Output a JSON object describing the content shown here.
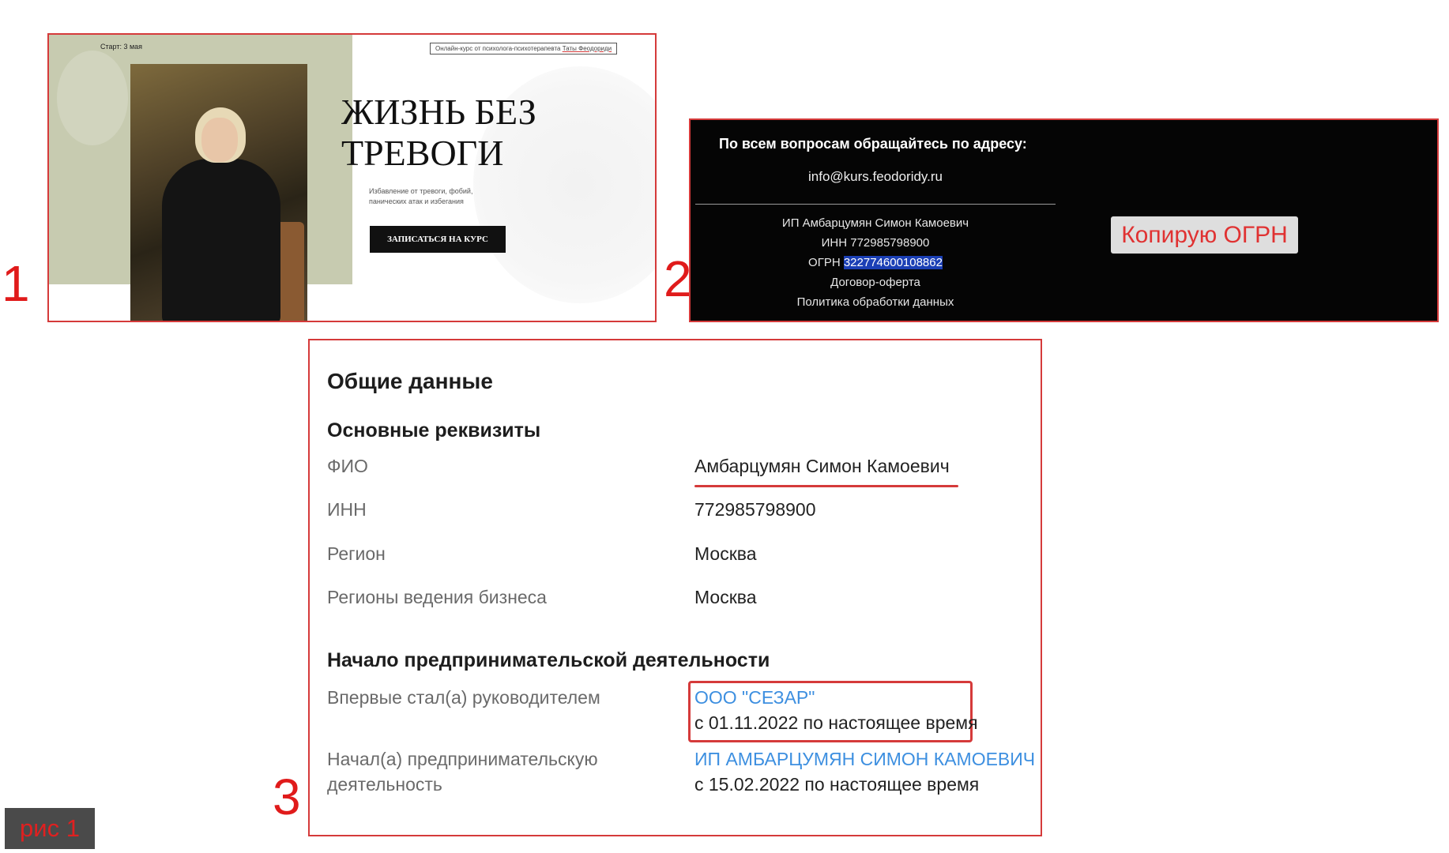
{
  "labels": {
    "one": "1",
    "two": "2",
    "three": "3",
    "tag": "рис 1"
  },
  "landing": {
    "start": "Старт: 3 мая",
    "badge_prefix": "Онлайн-курс от психолога-психотерапевта ",
    "badge_name": "Таты Феодориди",
    "title": "ЖИЗНЬ БЕЗ\nТРЕВОГИ",
    "subtitle": "Избавление от тревоги, фобий, панических атак и избегания",
    "cta": "ЗАПИСАТЬСЯ НА КУРС"
  },
  "footer": {
    "question": "По всем вопросам обращайтесь по адресу:",
    "email": "info@kurs.feodoridy.ru",
    "ip": "ИП Амбарцумян Симон Камоевич",
    "inn": "ИНН 772985798900",
    "ogrn_label": "ОГРН ",
    "ogrn_value": "322774600108862",
    "offer": "Договор-оферта",
    "policy": "Политика обработки данных",
    "copy_button": "Копирую ОГРН"
  },
  "registry": {
    "title": "Общие данные",
    "section1": "Основные реквизиты",
    "rows": [
      {
        "label": "ФИО",
        "value": "Амбарцумян Симон Камоевич"
      },
      {
        "label": "ИНН",
        "value": "772985798900"
      },
      {
        "label": "Регион",
        "value": "Москва"
      },
      {
        "label": "Регионы ведения бизнеса",
        "value": "Москва"
      }
    ],
    "section2": "Начало предпринимательской деятельности",
    "first_head_label": "Впервые стал(а) руководителем",
    "first_head_company": "ООО \"СЕЗАР\"",
    "first_head_period": "с 01.11.2022 по настоящее время",
    "started_label_1": "Начал(а) предпринимательскую",
    "started_label_2": "деятельность",
    "started_entity": "ИП АМБАРЦУМЯН СИМОН КАМОЕВИЧ",
    "started_period": "с 15.02.2022 по настоящее время"
  },
  "colors": {
    "accent_red": "#d53a3a",
    "link_blue": "#3d8fe0",
    "selection_blue": "#1b3fb5",
    "sage": "#c7cbb0"
  }
}
